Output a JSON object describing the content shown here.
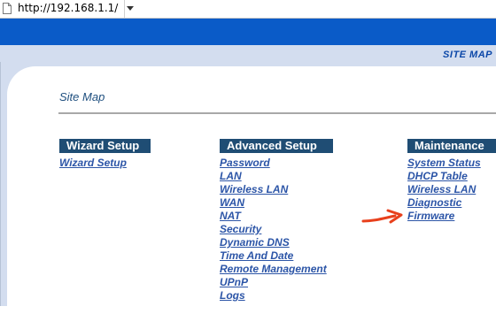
{
  "browser": {
    "url": "http://192.168.1.1/"
  },
  "header": {
    "site_map_label": "SITE MAP"
  },
  "page": {
    "title": "Site Map"
  },
  "columns": [
    {
      "heading": "Wizard Setup",
      "links": [
        "Wizard Setup"
      ]
    },
    {
      "heading": "Advanced Setup",
      "links": [
        "Password",
        "LAN",
        "Wireless LAN",
        "WAN",
        "NAT",
        "Security",
        "Dynamic DNS",
        "Time And Date",
        "Remote Management",
        "UPnP",
        "Logs"
      ]
    },
    {
      "heading": "Maintenance",
      "links": [
        "System Status",
        "DHCP Table",
        "Wireless LAN",
        "Diagnostic",
        "Firmware"
      ]
    }
  ],
  "colors": {
    "blue_bar": "#0a5bc8",
    "heading_bg": "#1f4d74",
    "link": "#2c55a7",
    "arrow": "#e8401c"
  }
}
